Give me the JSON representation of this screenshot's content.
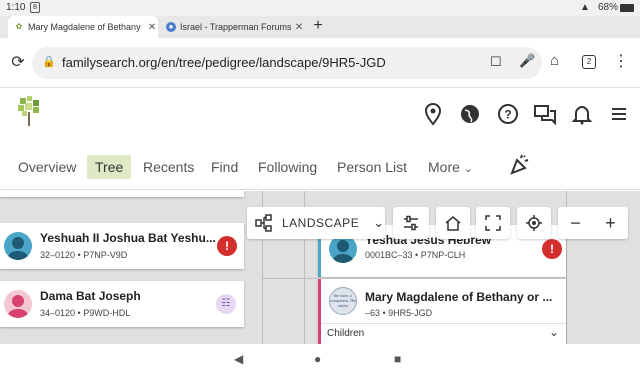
{
  "status_bar": {
    "time": "1:10",
    "notification": "8",
    "battery": "68%"
  },
  "tabs": [
    {
      "title": "Mary Magdalene of Bethany",
      "active": true
    },
    {
      "title": "Israel - Trapperman Forums",
      "active": false
    }
  ],
  "address_bar": {
    "url": "familysearch.org/en/tree/pedigree/landscape/9HR5-JGD",
    "tab_count": "2"
  },
  "nav": {
    "items": [
      "Overview",
      "Tree",
      "Recents",
      "Find",
      "Following",
      "Person List",
      "More"
    ],
    "active": "Tree"
  },
  "toolbar": {
    "view_label": "LANDSCAPE"
  },
  "persons": [
    {
      "name": "Yeshuah II Joshua Bat Yeshu...",
      "meta": "32–0120 • P7NP-V9D",
      "alert": "!"
    },
    {
      "name": "Dama Bat Joseph",
      "meta": "34–0120 • P9WD-HDL"
    },
    {
      "name": "Yeshua Jesus Hebrew",
      "meta": "0001BC–33 • P7NP-CLH",
      "alert": "!"
    },
    {
      "name": "Mary Magdalene of Bethany or ...",
      "meta": "–63 • 9HR5-JGD",
      "photo_text": "the sister, a companion, The sisters"
    }
  ],
  "children_label": "Children",
  "colors": {
    "accent_green": "#dfe9c6",
    "alert_red": "#d32f2f",
    "male_blue": "#4aa5c8",
    "female_pink": "#d6436e",
    "hint_purple": "#e6d8f3"
  },
  "icons": [
    "location-pin-icon",
    "globe-icon",
    "help-icon",
    "chat-icon",
    "bell-icon",
    "hamburger-menu-icon",
    "celebration-icon"
  ]
}
